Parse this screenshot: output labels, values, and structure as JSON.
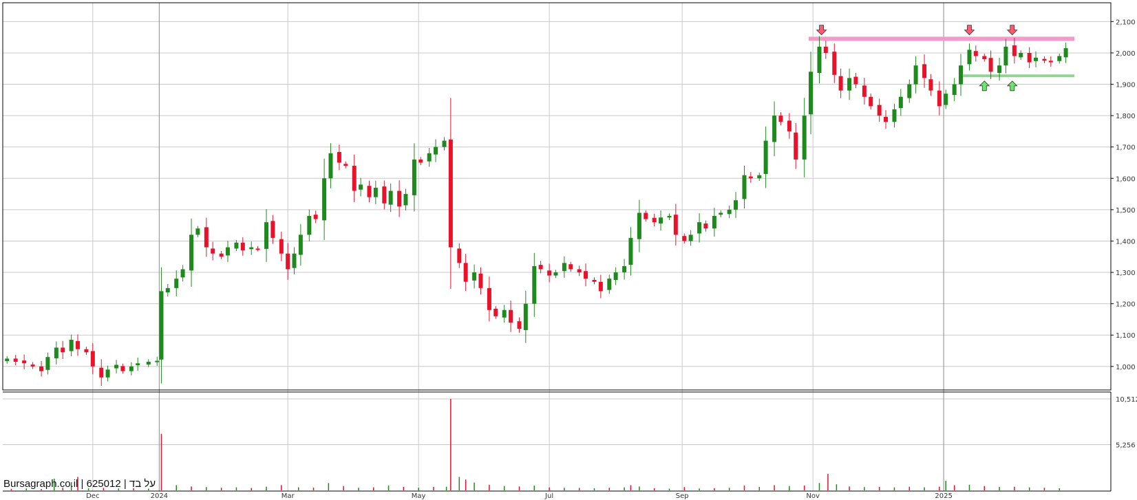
{
  "watermark": "Bursagraph.co.il | 625012 | על בד",
  "colors": {
    "up": "#1e8a1e",
    "down": "#e8132b",
    "grid": "#c8c8c8",
    "resistance": "#f59ac8",
    "support": "#8fd48f",
    "arrow_down": "#ff5a6e",
    "arrow_up": "#6fe36f"
  },
  "chart_data": [
    {
      "type": "candlestick",
      "title": "",
      "x_tick_labels": [
        "Dec",
        "2024",
        "Mar",
        "May",
        "Jul",
        "Sep",
        "Nov",
        "2025"
      ],
      "x_tick_dates": [
        "2023-12-01",
        "2024-01-01",
        "2024-03-01",
        "2024-05-01",
        "2024-07-01",
        "2024-09-01",
        "2024-11-01",
        "2025-01-01"
      ],
      "x_range": [
        "2023-10-20",
        "2025-03-20"
      ],
      "y_tick_values": [
        1000,
        1100,
        1200,
        1300,
        1400,
        1500,
        1600,
        1700,
        1800,
        1900,
        2000,
        2100
      ],
      "y_tick_labels": [
        "1,000",
        "1,100",
        "1,200",
        "1,300",
        "1,400",
        "1,500",
        "1,600",
        "1,700",
        "1,800",
        "1,900",
        "2,000",
        "2,100"
      ],
      "ylim": [
        925,
        2160
      ],
      "grid": true,
      "close_series": [
        [
          "2023-10-22",
          1025
        ],
        [
          "2023-10-26",
          1015
        ],
        [
          "2023-10-30",
          1010
        ],
        [
          "2023-11-03",
          1000
        ],
        [
          "2023-11-07",
          985
        ],
        [
          "2023-11-10",
          1030
        ],
        [
          "2023-11-14",
          1060
        ],
        [
          "2023-11-17",
          1045
        ],
        [
          "2023-11-21",
          1085
        ],
        [
          "2023-11-24",
          1055
        ],
        [
          "2023-11-28",
          1045
        ],
        [
          "2023-12-01",
          1000
        ],
        [
          "2023-12-05",
          965
        ],
        [
          "2023-12-08",
          990
        ],
        [
          "2023-12-12",
          1005
        ],
        [
          "2023-12-15",
          985
        ],
        [
          "2023-12-19",
          1000
        ],
        [
          "2023-12-22",
          1010
        ],
        [
          "2023-12-27",
          1015
        ],
        [
          "2023-12-31",
          1018
        ],
        [
          "2024-01-02",
          1240
        ],
        [
          "2024-01-05",
          1250
        ],
        [
          "2024-01-09",
          1280
        ],
        [
          "2024-01-12",
          1310
        ],
        [
          "2024-01-16",
          1420
        ],
        [
          "2024-01-19",
          1440
        ],
        [
          "2024-01-23",
          1380
        ],
        [
          "2024-01-26",
          1360
        ],
        [
          "2024-01-30",
          1350
        ],
        [
          "2024-02-02",
          1380
        ],
        [
          "2024-02-06",
          1395
        ],
        [
          "2024-02-09",
          1370
        ],
        [
          "2024-02-13",
          1380
        ],
        [
          "2024-02-16",
          1375
        ],
        [
          "2024-02-20",
          1460
        ],
        [
          "2024-02-23",
          1410
        ],
        [
          "2024-02-27",
          1360
        ],
        [
          "2024-03-01",
          1310
        ],
        [
          "2024-03-04",
          1360
        ],
        [
          "2024-03-07",
          1420
        ],
        [
          "2024-03-11",
          1480
        ],
        [
          "2024-03-14",
          1470
        ],
        [
          "2024-03-18",
          1600
        ],
        [
          "2024-03-21",
          1680
        ],
        [
          "2024-03-25",
          1650
        ],
        [
          "2024-03-28",
          1640
        ],
        [
          "2024-04-01",
          1560
        ],
        [
          "2024-04-04",
          1580
        ],
        [
          "2024-04-08",
          1540
        ],
        [
          "2024-04-11",
          1570
        ],
        [
          "2024-04-15",
          1520
        ],
        [
          "2024-04-18",
          1560
        ],
        [
          "2024-04-22",
          1510
        ],
        [
          "2024-04-25",
          1550
        ],
        [
          "2024-04-29",
          1660
        ],
        [
          "2024-05-02",
          1650
        ],
        [
          "2024-05-06",
          1680
        ],
        [
          "2024-05-09",
          1700
        ],
        [
          "2024-05-13",
          1720
        ],
        [
          "2024-05-16",
          1380
        ],
        [
          "2024-05-20",
          1330
        ],
        [
          "2024-05-23",
          1270
        ],
        [
          "2024-05-27",
          1300
        ],
        [
          "2024-05-30",
          1250
        ],
        [
          "2024-06-03",
          1180
        ],
        [
          "2024-06-06",
          1160
        ],
        [
          "2024-06-10",
          1180
        ],
        [
          "2024-06-13",
          1140
        ],
        [
          "2024-06-17",
          1120
        ],
        [
          "2024-06-20",
          1200
        ],
        [
          "2024-06-24",
          1320
        ],
        [
          "2024-06-27",
          1310
        ],
        [
          "2024-07-01",
          1290
        ],
        [
          "2024-07-04",
          1300
        ],
        [
          "2024-07-08",
          1330
        ],
        [
          "2024-07-11",
          1310
        ],
        [
          "2024-07-15",
          1300
        ],
        [
          "2024-07-18",
          1280
        ],
        [
          "2024-07-22",
          1270
        ],
        [
          "2024-07-25",
          1240
        ],
        [
          "2024-07-29",
          1280
        ],
        [
          "2024-08-01",
          1300
        ],
        [
          "2024-08-05",
          1320
        ],
        [
          "2024-08-08",
          1410
        ],
        [
          "2024-08-12",
          1490
        ],
        [
          "2024-08-15",
          1470
        ],
        [
          "2024-08-19",
          1460
        ],
        [
          "2024-08-22",
          1475
        ],
        [
          "2024-08-26",
          1480
        ],
        [
          "2024-08-29",
          1420
        ],
        [
          "2024-09-02",
          1400
        ],
        [
          "2024-09-05",
          1420
        ],
        [
          "2024-09-09",
          1460
        ],
        [
          "2024-09-12",
          1440
        ],
        [
          "2024-09-16",
          1480
        ],
        [
          "2024-09-19",
          1490
        ],
        [
          "2024-09-23",
          1500
        ],
        [
          "2024-09-26",
          1530
        ],
        [
          "2024-09-30",
          1610
        ],
        [
          "2024-10-03",
          1600
        ],
        [
          "2024-10-07",
          1610
        ],
        [
          "2024-10-10",
          1720
        ],
        [
          "2024-10-14",
          1800
        ],
        [
          "2024-10-17",
          1780
        ],
        [
          "2024-10-21",
          1750
        ],
        [
          "2024-10-24",
          1660
        ],
        [
          "2024-10-28",
          1800
        ],
        [
          "2024-10-31",
          1940
        ],
        [
          "2024-11-04",
          2020
        ],
        [
          "2024-11-07",
          2000
        ],
        [
          "2024-11-11",
          1930
        ],
        [
          "2024-11-14",
          1880
        ],
        [
          "2024-11-18",
          1920
        ],
        [
          "2024-11-21",
          1900
        ],
        [
          "2024-11-25",
          1860
        ],
        [
          "2024-11-28",
          1830
        ],
        [
          "2024-12-02",
          1800
        ],
        [
          "2024-12-05",
          1780
        ],
        [
          "2024-12-09",
          1820
        ],
        [
          "2024-12-12",
          1860
        ],
        [
          "2024-12-16",
          1900
        ],
        [
          "2024-12-19",
          1960
        ],
        [
          "2024-12-23",
          1920
        ],
        [
          "2024-12-26",
          1880
        ],
        [
          "2024-12-30",
          1830
        ],
        [
          "2025-01-02",
          1870
        ],
        [
          "2025-01-06",
          1900
        ],
        [
          "2025-01-09",
          1960
        ],
        [
          "2025-01-13",
          2010
        ],
        [
          "2025-01-16",
          1990
        ],
        [
          "2025-01-20",
          1980
        ],
        [
          "2025-01-23",
          1940
        ],
        [
          "2025-01-27",
          1960
        ],
        [
          "2025-01-30",
          2020
        ],
        [
          "2025-02-03",
          1990
        ],
        [
          "2025-02-06",
          2000
        ],
        [
          "2025-02-10",
          1970
        ],
        [
          "2025-02-13",
          1985
        ],
        [
          "2025-02-17",
          1975
        ],
        [
          "2025-02-20",
          1970
        ],
        [
          "2025-02-24",
          1990
        ],
        [
          "2025-02-27",
          2015
        ]
      ],
      "horizontal_lines": [
        {
          "role": "resistance",
          "y": 2045,
          "from": "2024-10-30",
          "to": "2025-03-03"
        },
        {
          "role": "support",
          "y": 1927,
          "from": "2025-01-10",
          "to": "2025-03-03"
        }
      ],
      "arrow_markers": [
        {
          "direction": "down",
          "date": "2024-11-05",
          "y": 2073
        },
        {
          "direction": "down",
          "date": "2025-01-13",
          "y": 2073
        },
        {
          "direction": "down",
          "date": "2025-02-02",
          "y": 2073
        },
        {
          "direction": "up",
          "date": "2025-01-20",
          "y": 1895
        },
        {
          "direction": "up",
          "date": "2025-02-02",
          "y": 1895
        }
      ]
    },
    {
      "type": "bar",
      "title": "",
      "y_tick_values": [
        5256,
        10512
      ],
      "y_tick_labels": [
        "5,256",
        "10,512"
      ],
      "ylim": [
        0,
        10512
      ],
      "volume_series": [
        [
          "2023-10-24",
          180
        ],
        [
          "2023-10-31",
          220
        ],
        [
          "2023-11-07",
          160
        ],
        [
          "2023-11-13",
          1350
        ],
        [
          "2023-11-17",
          300
        ],
        [
          "2023-11-21",
          950
        ],
        [
          "2023-11-24",
          1550
        ],
        [
          "2023-11-29",
          250
        ],
        [
          "2023-12-06",
          300
        ],
        [
          "2023-12-13",
          220
        ],
        [
          "2023-12-20",
          260
        ],
        [
          "2023-12-27",
          200
        ],
        [
          "2024-01-02",
          6500
        ],
        [
          "2024-01-09",
          600
        ],
        [
          "2024-01-16",
          450
        ],
        [
          "2024-01-23",
          380
        ],
        [
          "2024-01-30",
          300
        ],
        [
          "2024-02-06",
          350
        ],
        [
          "2024-02-13",
          280
        ],
        [
          "2024-02-20",
          420
        ],
        [
          "2024-02-27",
          600
        ],
        [
          "2024-03-06",
          360
        ],
        [
          "2024-03-13",
          320
        ],
        [
          "2024-03-20",
          850
        ],
        [
          "2024-03-27",
          500
        ],
        [
          "2024-04-03",
          300
        ],
        [
          "2024-04-10",
          350
        ],
        [
          "2024-04-17",
          550
        ],
        [
          "2024-04-24",
          400
        ],
        [
          "2024-05-01",
          300
        ],
        [
          "2024-05-08",
          400
        ],
        [
          "2024-05-14",
          420
        ],
        [
          "2024-05-16",
          10512
        ],
        [
          "2024-05-20",
          1550
        ],
        [
          "2024-05-23",
          1250
        ],
        [
          "2024-05-27",
          900
        ],
        [
          "2024-06-03",
          650
        ],
        [
          "2024-06-10",
          500
        ],
        [
          "2024-06-17",
          450
        ],
        [
          "2024-06-24",
          550
        ],
        [
          "2024-07-01",
          350
        ],
        [
          "2024-07-08",
          300
        ],
        [
          "2024-07-15",
          280
        ],
        [
          "2024-07-22",
          250
        ],
        [
          "2024-07-29",
          300
        ],
        [
          "2024-08-05",
          350
        ],
        [
          "2024-08-08",
          600
        ],
        [
          "2024-08-12",
          450
        ],
        [
          "2024-08-19",
          250
        ],
        [
          "2024-08-26",
          200
        ],
        [
          "2024-09-02",
          380
        ],
        [
          "2024-09-09",
          220
        ],
        [
          "2024-09-16",
          260
        ],
        [
          "2024-09-23",
          300
        ],
        [
          "2024-09-30",
          550
        ],
        [
          "2024-10-07",
          400
        ],
        [
          "2024-10-14",
          600
        ],
        [
          "2024-10-21",
          500
        ],
        [
          "2024-10-28",
          550
        ],
        [
          "2024-11-04",
          850
        ],
        [
          "2024-11-08",
          1900
        ],
        [
          "2024-11-12",
          700
        ],
        [
          "2024-11-18",
          450
        ],
        [
          "2024-11-25",
          380
        ],
        [
          "2024-12-02",
          400
        ],
        [
          "2024-12-09",
          350
        ],
        [
          "2024-12-16",
          420
        ],
        [
          "2024-12-23",
          350
        ],
        [
          "2024-12-30",
          420
        ],
        [
          "2025-01-02",
          1100
        ],
        [
          "2025-01-06",
          600
        ],
        [
          "2025-01-13",
          650
        ],
        [
          "2025-01-20",
          500
        ],
        [
          "2025-01-27",
          400
        ],
        [
          "2025-02-03",
          420
        ],
        [
          "2025-02-10",
          350
        ],
        [
          "2025-02-17",
          300
        ],
        [
          "2025-02-24",
          250
        ]
      ]
    }
  ]
}
